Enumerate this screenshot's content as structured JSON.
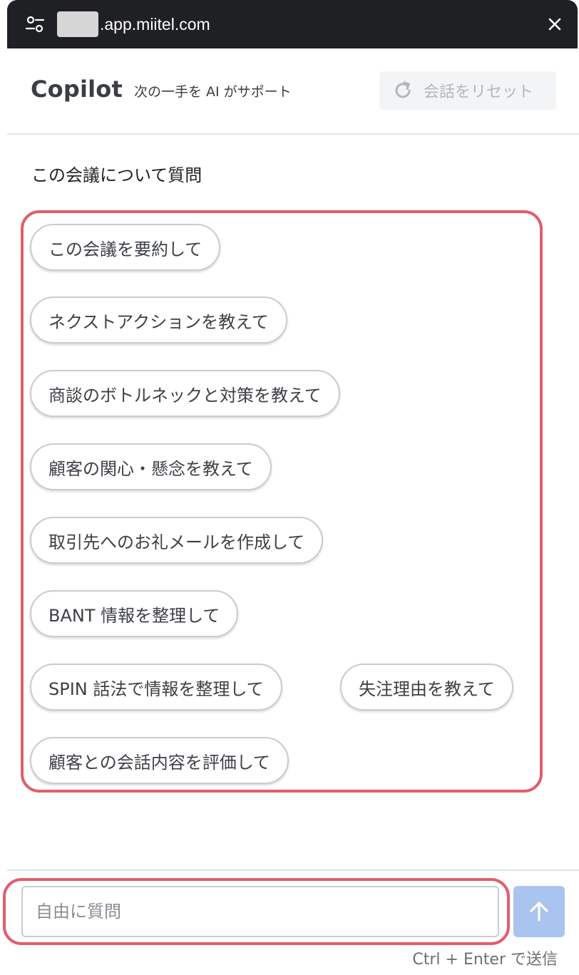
{
  "browser": {
    "url_suffix": ".app.miitel.com"
  },
  "header": {
    "title": "Copilot",
    "subtitle": "次の一手を AI がサポート",
    "reset_label": "会話をリセット"
  },
  "main": {
    "section_title": "この会議について質問",
    "suggestions": [
      "この会議を要約して",
      "ネクストアクションを教えて",
      "商談のボトルネックと対策を教えて",
      "顧客の関心・懸念を教えて",
      "取引先へのお礼メールを作成して",
      "BANT 情報を整理して",
      "SPIN 話法で情報を整理して",
      "失注理由を教えて",
      "顧客との会話内容を評価して"
    ]
  },
  "footer": {
    "input_placeholder": "自由に質問",
    "send_hint": "Ctrl + Enter で送信"
  },
  "colors": {
    "highlight": "#e35d6a",
    "send_button": "#a9c4ef"
  },
  "icons": {
    "site_settings": "sliders-icon",
    "close": "close-icon",
    "reset": "refresh-icon",
    "send": "arrow-up-icon"
  }
}
